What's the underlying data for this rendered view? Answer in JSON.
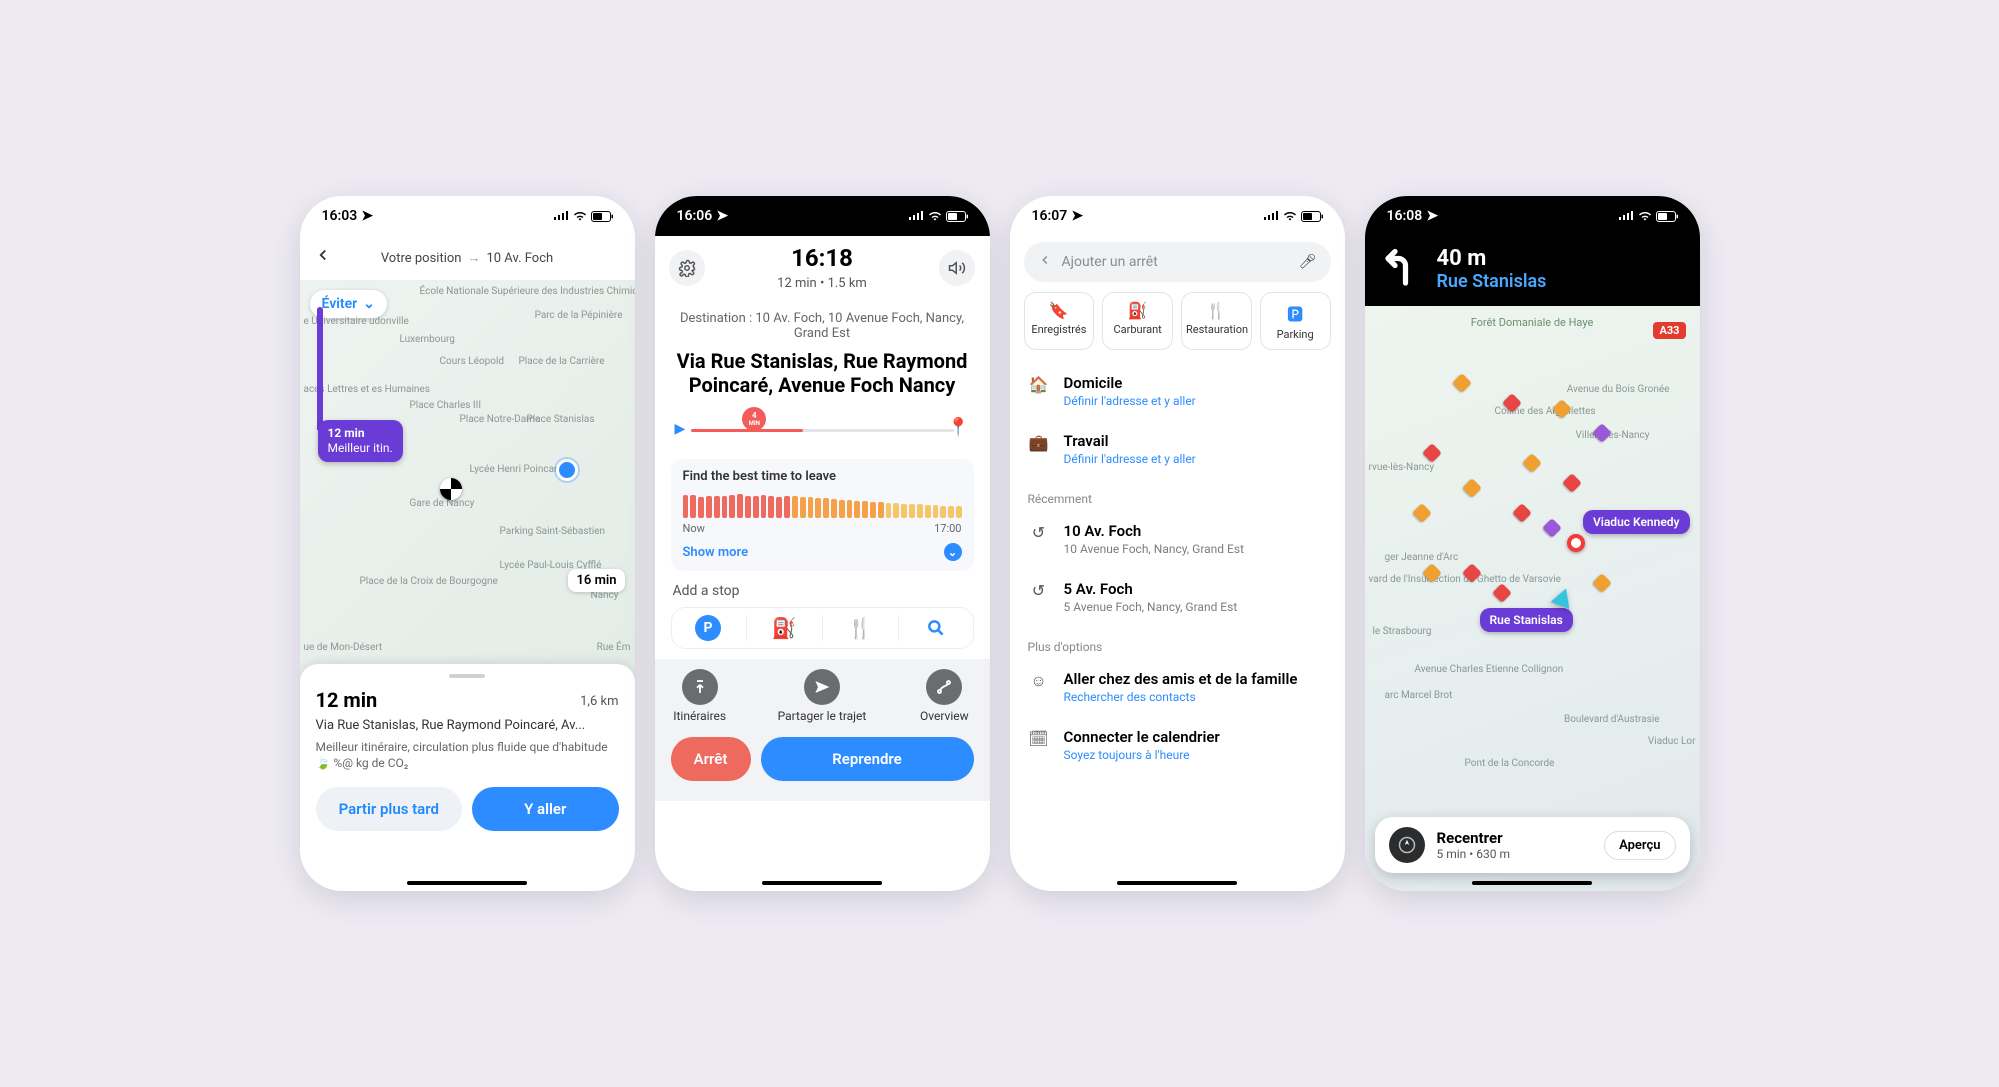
{
  "screen1": {
    "status_time": "16:03",
    "header_from": "Votre position",
    "header_to": "10 Av. Foch",
    "avoid_label": "Éviter",
    "route_badge_time": "12 min",
    "route_badge_sub": "Meilleur itin.",
    "alt_time": "16 min",
    "map_labels": [
      "École Nationale Supérieure des Industries Chimiques de Nancy",
      "Parc de la Pépinière",
      "Cours Léopold",
      "Place de la Carrière",
      "Place Charles III",
      "Place Notre-Dame",
      "Place Stanislas",
      "Lycée Henri Poincaré",
      "Gare de Nancy",
      "Parking Saint-Sébastien",
      "Lycée Paul-Louis Cyfflé",
      "Place de la Croix de Bourgogne",
      "Nancy",
      "ue de Mon-Désert",
      "Rue Ém",
      "aces Lettres et es Humaines",
      "e Universitaire udonville",
      "Luxembourg"
    ],
    "sheet": {
      "time": "12 min",
      "distance": "1,6 km",
      "via": "Via Rue Stanislas, Rue Raymond Poincaré, Av...",
      "note": "Meilleur itinéraire, circulation plus fluide que d'habitude  🍃 %@ kg de CO₂",
      "later": "Partir plus tard",
      "go": "Y aller"
    }
  },
  "screen2": {
    "status_time": "16:06",
    "arrival": "16:18",
    "eta_sub": "12 min  •  1.5 km",
    "destination_label": "Destination : 10 Av. Foch, 10 Avenue Foch, Nancy, Grand Est",
    "via": "Via Rue Stanislas, Rue Raymond Poincaré, Avenue Foch Nancy",
    "slider_bubble": "4",
    "slider_bubble_unit": "MIN",
    "best_time": "Find the best time to leave",
    "range_from": "Now",
    "range_to": "17:00",
    "show_more": "Show more",
    "add_stop": "Add a stop",
    "stop_icons": [
      "P",
      "⛽",
      "🍴",
      "🔍"
    ],
    "actions": [
      "Itinéraires",
      "Partager le trajet",
      "Overview"
    ],
    "stop_btn": "Arrêt",
    "resume_btn": "Reprendre"
  },
  "screen3": {
    "status_time": "16:07",
    "search_placeholder": "Ajouter un arrêt",
    "chips": [
      {
        "icon": "🔖",
        "label": "Enregistrés",
        "color": "#e88a2a"
      },
      {
        "icon": "⛽",
        "label": "Carburant",
        "color": "#2a9d4a"
      },
      {
        "icon": "🍴",
        "label": "Restauration",
        "color": "#6d6f73"
      },
      {
        "icon": "🅿︎",
        "label": "Parking",
        "color": "#2d8cff"
      }
    ],
    "rows_primary": [
      {
        "icon": "🏠",
        "title": "Domicile",
        "sub": "Définir l'adresse et y aller",
        "link": true
      },
      {
        "icon": "💼",
        "title": "Travail",
        "sub": "Définir l'adresse et y aller",
        "link": true
      }
    ],
    "section_recent": "Récemment",
    "rows_recent": [
      {
        "icon": "↺",
        "title": "10 Av. Foch",
        "sub": "10 Avenue Foch, Nancy, Grand Est",
        "link": false
      },
      {
        "icon": "↺",
        "title": "5 Av. Foch",
        "sub": "5 Avenue Foch, Nancy, Grand Est",
        "link": false
      }
    ],
    "section_more": "Plus d'options",
    "rows_more": [
      {
        "icon": "☺",
        "title": "Aller chez des amis et de la famille",
        "sub": "Rechercher des contacts",
        "link": true
      },
      {
        "icon": "🗓",
        "title": "Connecter le calendrier",
        "sub": "Soyez toujours à l'heure",
        "link": true
      }
    ]
  },
  "screen4": {
    "status_time": "16:08",
    "distance": "40 m",
    "street": "Rue Stanislas",
    "forest": "Forêt Domaniale de Haye",
    "road_badge": "A33",
    "map_labels": [
      "Avenue du Bois Gronée",
      "Colline des Aiguillettes",
      "Villers-lès-Nancy",
      "rvue-lès-Nancy",
      "ger Jeanne d'Arc",
      "vard de l'Insurrection du Ghetto de Varsovie",
      "le Strasbourg",
      "Avenue Charles Etienne Collignon",
      "arc Marcel Brot",
      "Boulevard d'Austrasie",
      "Viaduc Lor",
      "Pont de la Concorde"
    ],
    "tags": [
      "Viaduc Kennedy",
      "Rue Stanislas"
    ],
    "recentrer": "Recentrer",
    "recentrer_sub": "5 min • 630 m",
    "apercu": "Aperçu"
  }
}
